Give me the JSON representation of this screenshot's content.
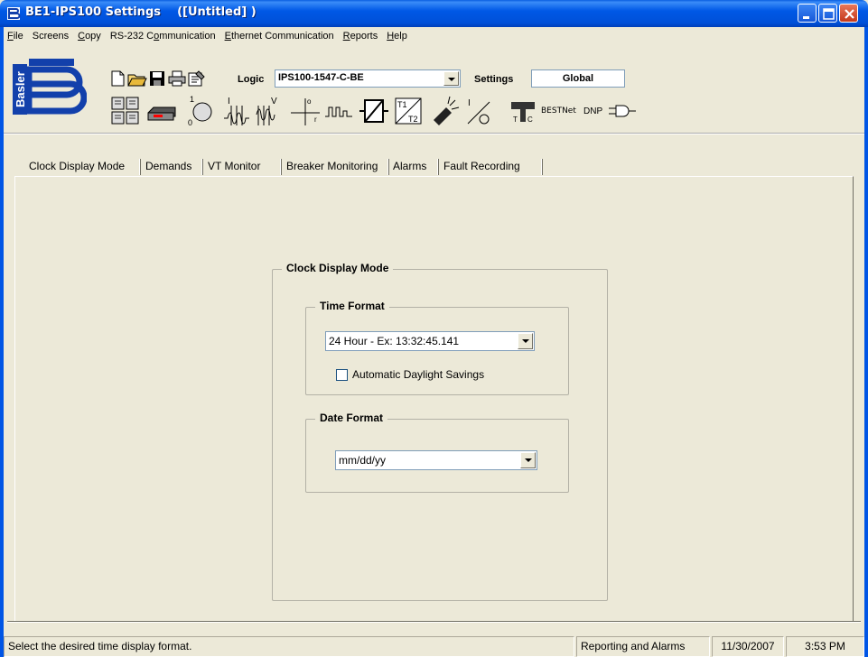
{
  "window": {
    "title": "BE1-IPS100 Settings    ([Untitled] )"
  },
  "menu": {
    "items": [
      {
        "label": "File",
        "accel": "F",
        "rest": "ile"
      },
      {
        "label": "Screens",
        "accel": "",
        "rest": "Screens"
      },
      {
        "label": "Copy",
        "accel": "C",
        "rest": "opy"
      },
      {
        "label": "RS-232 Communication",
        "pre": "RS-232 C",
        "accel": "o",
        "rest": "mmunication"
      },
      {
        "label": "Ethernet Communication",
        "accel": "E",
        "rest": "thernet Communication"
      },
      {
        "label": "Reports",
        "accel": "R",
        "rest": "eports"
      },
      {
        "label": "Help",
        "accel": "H",
        "rest": "elp"
      }
    ]
  },
  "toolbar": {
    "logic_label": "Logic",
    "logic_value": "IPS100-1547-C-BE",
    "settings_label": "Settings",
    "settings_value": "Global",
    "logo_text": "Basler",
    "bestnet_label": "BESTNet",
    "dnp_label": "DNP"
  },
  "tabs": [
    {
      "label": "Clock Display Mode",
      "active": true
    },
    {
      "label": "Demands"
    },
    {
      "label": "VT Monitor"
    },
    {
      "label": "Breaker Monitoring"
    },
    {
      "label": "Alarms"
    },
    {
      "label": "Fault Recording"
    }
  ],
  "clock": {
    "group_title": "Clock Display Mode",
    "time_format": {
      "title": "Time Format",
      "selected": "24 Hour - Ex: 13:32:45.141",
      "dst_label": "Automatic Daylight Savings",
      "dst_checked": false
    },
    "date_format": {
      "title": "Date Format",
      "selected": "mm/dd/yy"
    }
  },
  "status": {
    "message": "Select the desired time display format.",
    "section": "Reporting and Alarms",
    "date": "11/30/2007",
    "time": "3:53 PM"
  },
  "colors": {
    "titlebar": "#0058E6",
    "face": "#ECE9D8",
    "logo_blue": "#1240AB"
  }
}
